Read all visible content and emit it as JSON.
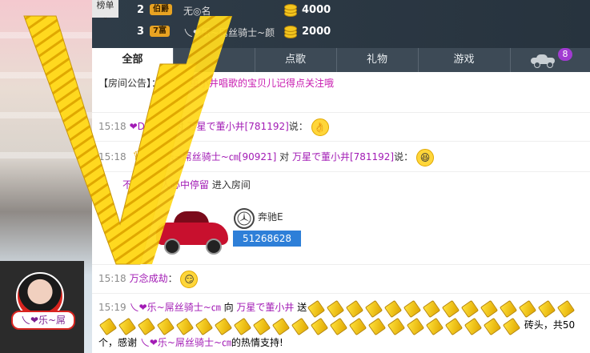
{
  "rank": {
    "tab_label": "榜单",
    "rows": [
      {
        "num": "2",
        "badge": "伯爵",
        "name": "无◎名",
        "value": "4000"
      },
      {
        "num": "3",
        "badge": "7富",
        "name": "乀❤乐~屌丝骑士~颜",
        "value": "2000"
      }
    ]
  },
  "tabs": [
    {
      "label": "全部"
    },
    {
      "label": ""
    },
    {
      "label": "点歌"
    },
    {
      "label": "礼物"
    },
    {
      "label": "游戏"
    }
  ],
  "car_badge": "8",
  "chat": {
    "announcement_prefix": "【房间公告】：",
    "announcement_text": "喜欢听董小井唱歌的宝贝儿记得点关注哦",
    "messages": [
      {
        "time": "15:18",
        "from": "❤DOY❤F",
        "middle": " 对 ",
        "to": "万星で董小井[781192]",
        "suffix": "说：",
        "icon": "ok-hand-emoji"
      },
      {
        "time": "15:18",
        "from": "乀❤乐~屌丝骑士~㎝[90921]",
        "middle": " 对 ",
        "to": "万星で董小井[781192]",
        "suffix": "说：",
        "icon": "laughing-emoji"
      },
      {
        "time": "",
        "from": "不在任何人心中停留",
        "middle": "",
        "to": "",
        "suffix": " 进入房间",
        "icon": ""
      },
      {
        "time": "15:18",
        "from": "万念成劫",
        "middle": "",
        "to": "",
        "suffix": "：",
        "icon": "smirk-emoji"
      }
    ],
    "car": {
      "brand": "奔驰E",
      "id": "51268628"
    },
    "gift_msg": {
      "time": "15:19",
      "from": "乀❤乐~屌丝骑士~㎝",
      "to_prefix": " 向 ",
      "to": "万星で董小井",
      "send": " 送",
      "tail": "砖头，共50个，感谢",
      "thanks_name": "乀❤乐~屌丝骑士~㎝",
      "end": "的热情支持!",
      "gift_count": 50
    }
  },
  "avatar": {
    "name": "乀❤乐~屌"
  },
  "colors": {
    "accent": "#a21bb5",
    "announce": "#c81bb0",
    "id_badge": "#2e7fd8",
    "gold": "#f3c51e"
  }
}
